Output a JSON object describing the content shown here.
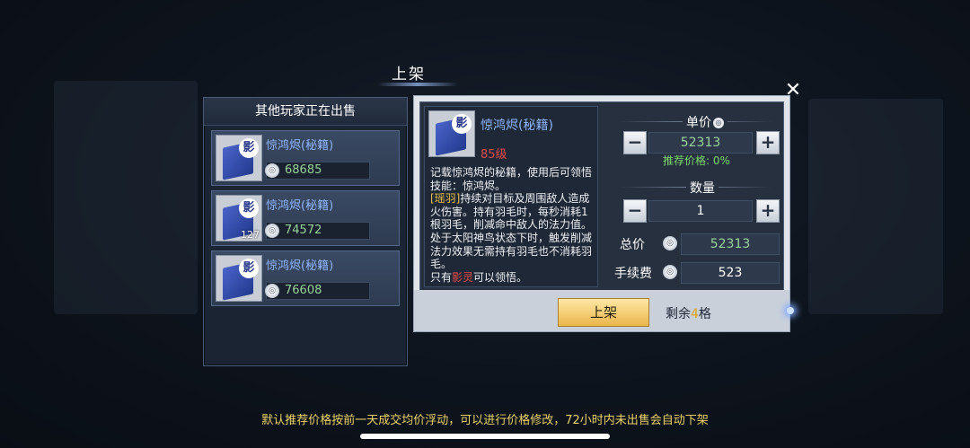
{
  "title": "上架",
  "other_sellers": {
    "header": "其他玩家正在出售",
    "listings": [
      {
        "name": "惊鸿烬(秘籍)",
        "price": "68685",
        "qty": ""
      },
      {
        "name": "惊鸿烬(秘籍)",
        "price": "74572",
        "qty": "127"
      },
      {
        "name": "惊鸿烬(秘籍)",
        "price": "76608",
        "qty": ""
      }
    ]
  },
  "item": {
    "icon_badge": "影",
    "name": "惊鸿烬(秘籍)",
    "level": "85级",
    "desc_1": "记载惊鸿烬的秘籍，使用后可领悟技能：惊鸿烬。",
    "desc_tag": "[瑶羽]",
    "desc_2": "持续对目标及周围敌人造成火伤害。持有羽毛时，每秒消耗1根羽毛，削减命中敌人的法力值。处于太阳神鸟状态下时，触发削减法力效果无需持有羽毛也不消耗羽毛。",
    "desc_3a": "只有",
    "desc_class": "影灵",
    "desc_3b": "可以领悟。"
  },
  "pricing": {
    "unit_price_label": "单价",
    "unit_price": "52313",
    "recommend": "推荐价格: 0%",
    "quantity_label": "数量",
    "quantity": "1",
    "total_label": "总价",
    "total": "52313",
    "fee_label": "手续费",
    "fee": "523",
    "minus": "−",
    "plus": "+"
  },
  "actions": {
    "list_button": "上架",
    "slots_prefix": "剩余",
    "slots_count": "4",
    "slots_suffix": "格",
    "close": "✕"
  },
  "footer_note": "默认推荐价格按前一天成交均价浮动，可以进行价格修改，72小时内未出售会自动下架",
  "icons": {
    "coin": "silver-coin-icon",
    "book": "skill-book-icon",
    "close": "close-icon"
  },
  "colors": {
    "price_green": "#9ad39a",
    "name_blue": "#8fb6ff",
    "level_red": "#e24b4b",
    "button_gold": "#e9b64a",
    "note_yellow": "#e8d36a"
  }
}
